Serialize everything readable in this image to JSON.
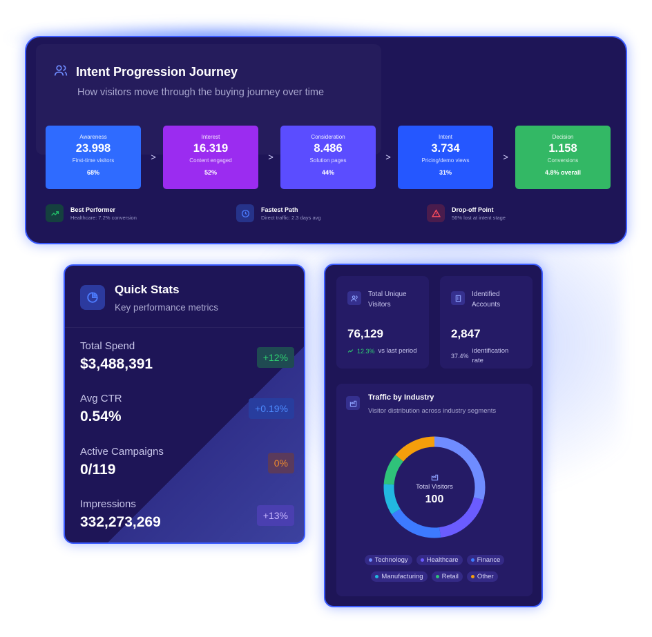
{
  "journey": {
    "title": "Intent Progression Journey",
    "subtitle": "How visitors move through the buying journey over time",
    "stages": [
      {
        "name": "Awareness",
        "value": "23.998",
        "desc": "First-time visitors",
        "pct": "68%",
        "color": "#2f6bff"
      },
      {
        "name": "Interest",
        "value": "16.319",
        "desc": "Content engaged",
        "pct": "52%",
        "color": "#9b2cf0"
      },
      {
        "name": "Consideration",
        "value": "8.486",
        "desc": "Solution pages",
        "pct": "44%",
        "color": "#5b4dff"
      },
      {
        "name": "Intent",
        "value": "3.734",
        "desc": "Pricing/demo views",
        "pct": "31%",
        "color": "#2557ff"
      },
      {
        "name": "Decision",
        "value": "1.158",
        "desc": "Conversions",
        "pct": "4.8% overall",
        "color": "#33b865"
      }
    ],
    "arrow": ">",
    "insights": [
      {
        "title": "Best Performer",
        "detail": "Healthcare: 7.2% conversion",
        "icon": "trending-up-icon",
        "color": "#22c06a"
      },
      {
        "title": "Fastest Path",
        "detail": "Direct traffic: 2.3 days avg",
        "icon": "clock-icon",
        "color": "#4d7cff"
      },
      {
        "title": "Drop-off Point",
        "detail": "56% lost at intent stage",
        "icon": "warning-icon",
        "color": "#ff4d5e"
      }
    ]
  },
  "quick_stats": {
    "title": "Quick Stats",
    "subtitle": "Key performance metrics",
    "rows": [
      {
        "label": "Total Spend",
        "value": "$3,488,391",
        "badge": "+12%",
        "badge_color": "#2fcf72"
      },
      {
        "label": "Avg CTR",
        "value": "0.54%",
        "badge": "+0.19%",
        "badge_color": "#4d8bff"
      },
      {
        "label": "Active Campaigns",
        "value": "0/119",
        "badge": "0%",
        "badge_color": "#f08a2e"
      },
      {
        "label": "Impressions",
        "value": "332,273,269",
        "badge": "+13%",
        "badge_color": "#b08cff"
      }
    ]
  },
  "visitors": {
    "title": "Total Unique Visitors",
    "value": "76,129",
    "change": "12.3%",
    "change_label": "vs last period"
  },
  "accounts": {
    "title": "Identified Accounts",
    "value": "2,847",
    "rate": "37.4%",
    "rate_label": "identification rate"
  },
  "traffic": {
    "title": "Traffic by Industry",
    "subtitle": "Visitor distribution across industry segments",
    "center_label": "Total Visitors",
    "center_value": "100",
    "legend": [
      {
        "label": "Technology",
        "color": "#6f8cff"
      },
      {
        "label": "Healthcare",
        "color": "#6b5cff"
      },
      {
        "label": "Finance",
        "color": "#3d7bff"
      },
      {
        "label": "Manufacturing",
        "color": "#22b8e0"
      },
      {
        "label": "Retail",
        "color": "#2fc27a"
      },
      {
        "label": "Other",
        "color": "#f59e0b"
      }
    ]
  },
  "chart_data": {
    "type": "pie",
    "categories": [
      "Technology",
      "Healthcare",
      "Finance",
      "Manufacturing",
      "Retail",
      "Other"
    ],
    "values": [
      29,
      19,
      18,
      10,
      10,
      14
    ],
    "colors": [
      "#6f8cff",
      "#6b5cff",
      "#3d7bff",
      "#22b8e0",
      "#2fc27a",
      "#f59e0b"
    ]
  }
}
